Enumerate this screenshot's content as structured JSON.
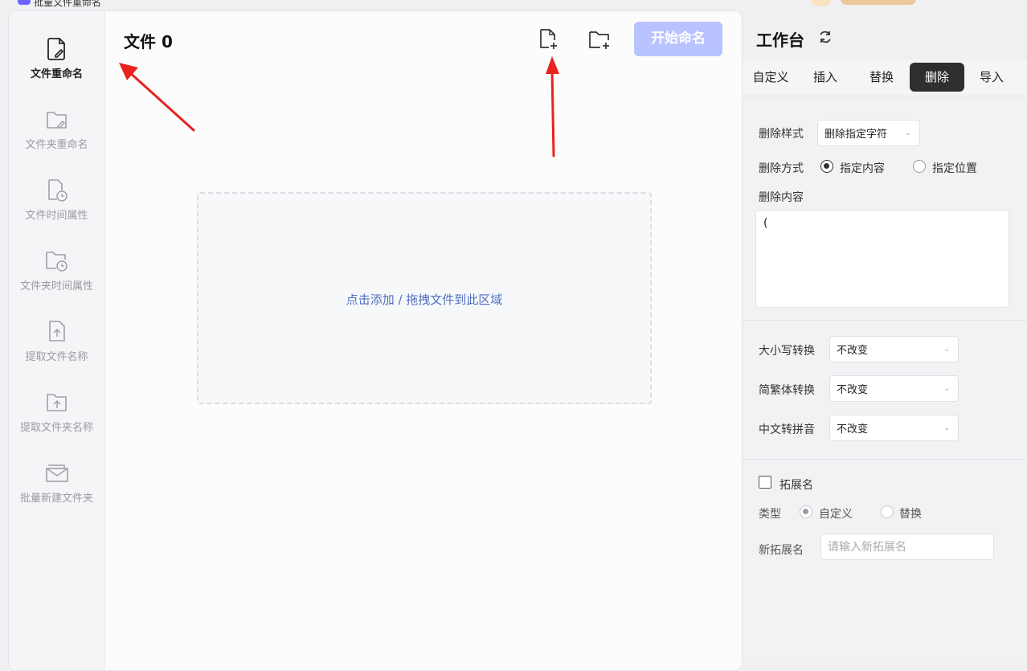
{
  "window": {
    "title": "批量文件重命名"
  },
  "sidebar": {
    "items": [
      {
        "label": "文件重命名",
        "icon": "file-edit-icon",
        "active": true
      },
      {
        "label": "文件夹重命名",
        "icon": "folder-edit-icon",
        "active": false
      },
      {
        "label": "文件时间属性",
        "icon": "file-clock-icon",
        "active": false
      },
      {
        "label": "文件夹时间属性",
        "icon": "folder-clock-icon",
        "active": false
      },
      {
        "label": "提取文件名称",
        "icon": "file-upload-icon",
        "active": false
      },
      {
        "label": "提取文件夹名称",
        "icon": "folder-upload-icon",
        "active": false
      },
      {
        "label": "批量新建文件夹",
        "icon": "folder-stack-icon",
        "active": false
      }
    ]
  },
  "main": {
    "files_title": "文件 0",
    "add_file_icon": "file-plus-icon",
    "add_folder_icon": "folder-plus-icon",
    "start_button": "开始命名",
    "dropzone_hint": "点击添加 / 拖拽文件到此区域"
  },
  "panel": {
    "title": "工作台",
    "refresh_icon": "refresh-icon",
    "tabs": [
      {
        "label": "自定义",
        "active": false
      },
      {
        "label": "插入",
        "active": false
      },
      {
        "label": "替换",
        "active": false
      },
      {
        "label": "删除",
        "active": true
      },
      {
        "label": "导入",
        "active": false
      }
    ],
    "delete_style_label": "删除样式",
    "delete_style_value": "删除指定字符",
    "delete_mode_label": "删除方式",
    "delete_mode_options": [
      "指定内容",
      "指定位置"
    ],
    "delete_mode_selected": "指定内容",
    "delete_content_label": "删除内容",
    "delete_content_value": "(",
    "case_label": "大小写转换",
    "case_value": "不改变",
    "trad_label": "简繁体转换",
    "trad_value": "不改变",
    "pinyin_label": "中文转拼音",
    "pinyin_value": "不改变",
    "ext_checkbox_label": "拓展名",
    "ext_checked": false,
    "type_label": "类型",
    "type_options": [
      "自定义",
      "替换"
    ],
    "type_selected": "自定义",
    "new_ext_label": "新拓展名",
    "new_ext_placeholder": "请输入新拓展名"
  },
  "colors": {
    "accent": "#b8c3ff",
    "active_tab": "#2f2f31",
    "hint_text": "#4f6fbf",
    "annotation_arrow": "#e8231f"
  }
}
